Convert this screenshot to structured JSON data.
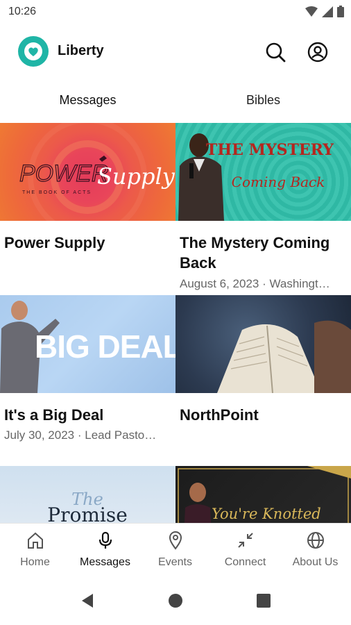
{
  "status": {
    "time": "10:26"
  },
  "app": {
    "title": "Liberty"
  },
  "tabs": [
    {
      "label": "Messages",
      "active": true
    },
    {
      "label": "Bibles",
      "active": false
    }
  ],
  "cards": [
    {
      "title": "Power Supply",
      "subtitle": "",
      "art": {
        "title": "POWER",
        "script": "Supply",
        "small": "THE BOOK OF ACTS"
      }
    },
    {
      "title": "The Mystery Coming Back",
      "subtitle": "August 6, 2023 · Washingt…",
      "art": {
        "title": "THE MYSTERY",
        "script": "Coming Back"
      }
    },
    {
      "title": "It's a Big Deal",
      "subtitle": "July 30, 2023 · Lead Pasto…",
      "art": {
        "title": "BIG DEAL"
      }
    },
    {
      "title": "NorthPoint",
      "subtitle": "",
      "art": {}
    },
    {
      "title": "",
      "subtitle": "",
      "art": {
        "script": "The",
        "title": "Promise"
      }
    },
    {
      "title": "",
      "subtitle": "",
      "art": {
        "script": "You're Knotted"
      }
    }
  ],
  "nav": [
    {
      "label": "Home",
      "icon": "home-icon",
      "active": false
    },
    {
      "label": "Messages",
      "icon": "microphone-icon",
      "active": true
    },
    {
      "label": "Events",
      "icon": "location-pin-icon",
      "active": false
    },
    {
      "label": "Connect",
      "icon": "arrows-in-icon",
      "active": false
    },
    {
      "label": "About Us",
      "icon": "globe-icon",
      "active": false
    }
  ],
  "colors": {
    "accent": "#1fb5a6"
  }
}
